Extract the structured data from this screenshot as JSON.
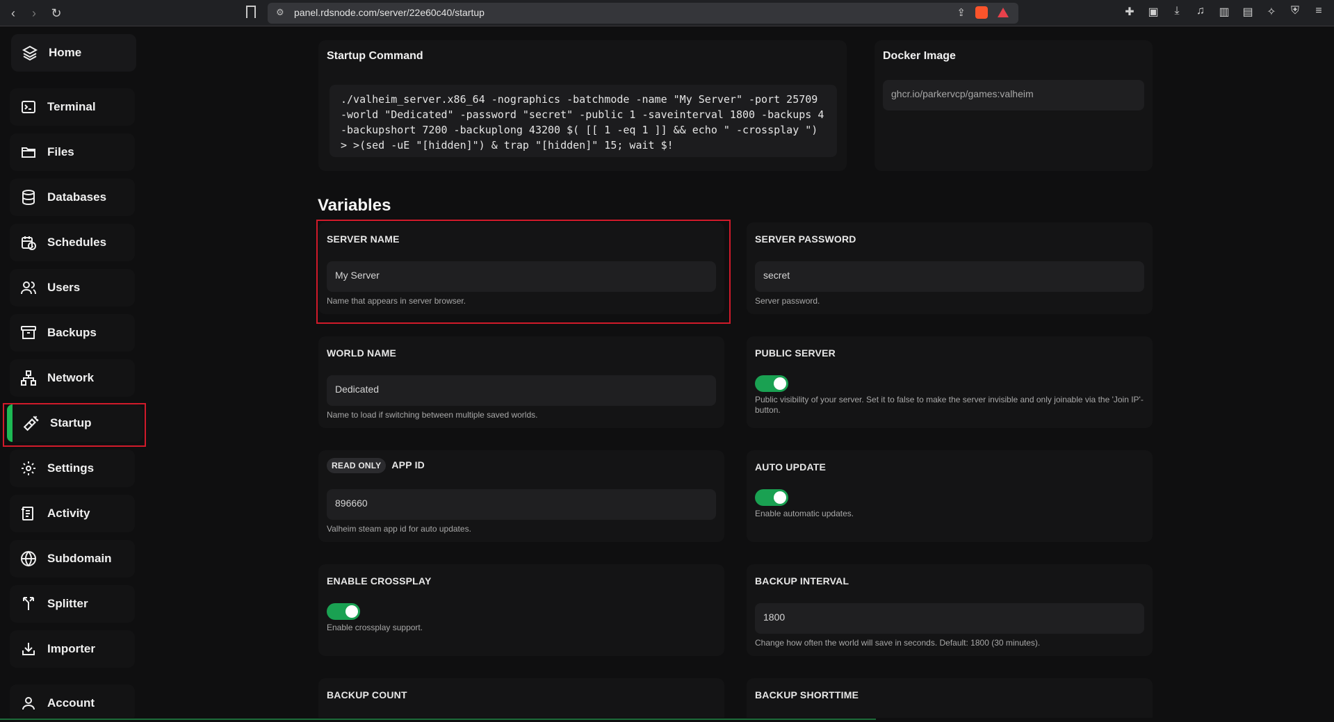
{
  "browser": {
    "url": "panel.rdsnode.com/server/22e60c40/startup"
  },
  "sidebar": {
    "items": [
      {
        "label": "Home",
        "icon": "layers-icon"
      },
      {
        "label": "Terminal",
        "icon": "terminal-icon"
      },
      {
        "label": "Files",
        "icon": "folder-icon"
      },
      {
        "label": "Databases",
        "icon": "database-icon"
      },
      {
        "label": "Schedules",
        "icon": "calendar-clock-icon"
      },
      {
        "label": "Users",
        "icon": "users-icon"
      },
      {
        "label": "Backups",
        "icon": "archive-icon"
      },
      {
        "label": "Network",
        "icon": "network-icon"
      },
      {
        "label": "Startup",
        "icon": "plug-icon"
      },
      {
        "label": "Settings",
        "icon": "gear-icon"
      },
      {
        "label": "Activity",
        "icon": "activity-log-icon"
      },
      {
        "label": "Subdomain",
        "icon": "globe-icon"
      },
      {
        "label": "Splitter",
        "icon": "split-icon"
      },
      {
        "label": "Importer",
        "icon": "import-icon"
      },
      {
        "label": "Account",
        "icon": "user-icon"
      }
    ],
    "active": "Startup",
    "accent": "#1db954"
  },
  "startup": {
    "title": "Startup Command",
    "command": "./valheim_server.x86_64 -nographics -batchmode -name \"My Server\" -port 25709\n-world \"Dedicated\" -password \"secret\" -public 1 -saveinterval 1800 -backups 4\n-backupshort 7200 -backuplong 43200 $( [[ 1 -eq 1 ]] && echo \" -crossplay \")\n> >(sed -uE \"[hidden]\") & trap \"[hidden]\" 15; wait $!"
  },
  "docker": {
    "title": "Docker Image",
    "value": "ghcr.io/parkervcp/games:valheim"
  },
  "variables": {
    "heading": "Variables",
    "server_name": {
      "label": "SERVER NAME",
      "value": "My Server",
      "help": "Name that appears in server browser."
    },
    "server_password": {
      "label": "SERVER PASSWORD",
      "value": "secret",
      "help": "Server password."
    },
    "world_name": {
      "label": "WORLD NAME",
      "value": "Dedicated",
      "help": "Name to load if switching between multiple saved worlds."
    },
    "public_server": {
      "label": "PUBLIC SERVER",
      "enabled": true,
      "help": "Public visibility of your server. Set it to false to make the server invisible and only joinable via the 'Join IP'-button."
    },
    "app_id": {
      "badge": "READ ONLY",
      "label": "APP ID",
      "value": "896660",
      "help": "Valheim steam app id for auto updates."
    },
    "auto_update": {
      "label": "AUTO UPDATE",
      "enabled": true,
      "help": "Enable automatic updates."
    },
    "crossplay": {
      "label": "ENABLE CROSSPLAY",
      "enabled": true,
      "help": "Enable crossplay support."
    },
    "backup_interval": {
      "label": "BACKUP INTERVAL",
      "value": "1800",
      "help": "Change how often the world will save in seconds. Default: 1800 (30 minutes)."
    },
    "backup_count": {
      "label": "BACKUP COUNT"
    },
    "backup_shorttime": {
      "label": "BACKUP SHORTTIME"
    }
  },
  "colors": {
    "toggle_on": "#1aa152",
    "highlight": "#d11a2a"
  }
}
